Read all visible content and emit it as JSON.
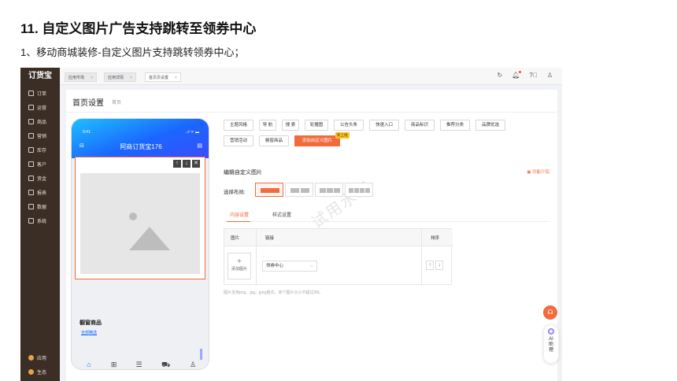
{
  "doc": {
    "title": "11. 自定义图片广告支持跳转至领券中心",
    "subtitle": "1、移动商城装修-自定义图片支持跳转领券中心；"
  },
  "sidebar": {
    "logo": "订货宝",
    "items": [
      {
        "label": "订单",
        "icon": "order-icon"
      },
      {
        "label": "运营",
        "icon": "operation-icon"
      },
      {
        "label": "商品",
        "icon": "goods-icon"
      },
      {
        "label": "营销",
        "icon": "marketing-icon"
      },
      {
        "label": "库存",
        "icon": "warehouse-icon"
      },
      {
        "label": "客户",
        "icon": "customer-icon"
      },
      {
        "label": "资金",
        "icon": "fund-icon"
      },
      {
        "label": "报表",
        "icon": "report-icon"
      },
      {
        "label": "数据",
        "icon": "data-icon"
      },
      {
        "label": "系统",
        "icon": "system-icon"
      }
    ],
    "bottom_items": [
      {
        "label": "应用",
        "icon": "apps-icon"
      },
      {
        "label": "生态",
        "icon": "ecosystem-icon"
      }
    ]
  },
  "tabs": [
    {
      "label": "应用市场",
      "close": "×"
    },
    {
      "label": "应用详情",
      "close": "×"
    },
    {
      "label": "首页页设置",
      "close": "×"
    }
  ],
  "top_icons": [
    "refresh-icon",
    "bell-icon",
    "help-icon",
    "user-icon"
  ],
  "page": {
    "title": "首页设置",
    "crumb": "首页"
  },
  "phone": {
    "time": "9:41",
    "signal": "..ıl ᯤ ▬",
    "app_title": "阿商订货宝176",
    "controls": [
      "↑",
      "↓",
      "✕"
    ],
    "window_title": "橱窗商品",
    "window_link": "全部精选",
    "nav": [
      {
        "label": "首页",
        "glyph": "⌂"
      },
      {
        "label": "分类",
        "glyph": "⊞"
      },
      {
        "label": "订单",
        "glyph": "☰"
      },
      {
        "label": "购物车",
        "glyph": "⛟"
      },
      {
        "label": "我的",
        "glyph": "♙"
      }
    ]
  },
  "components": {
    "row1": [
      "主题风格",
      "导 航",
      "搜 索",
      "轮播图",
      "公告头条",
      "快速入口",
      "商品标识",
      "推荐分类",
      "品牌优选"
    ],
    "row2": [
      "营销活动",
      "橱窗商品",
      "添加自定义图片"
    ],
    "new_badge": "新上线"
  },
  "editor": {
    "title": "编辑自定义图片",
    "help": "功能介绍",
    "layout_label": "选择布局:",
    "sub_tabs": [
      "内容设置",
      "样式设置"
    ],
    "table_headers": [
      "图片",
      "链接",
      "排序"
    ],
    "add_image": "添加图片",
    "link_value": "领券中心",
    "sort_up": "↑",
    "sort_down": "↓",
    "hint": "图片支持png、jpg、jpeg格式，单个图片大小不超过2M。"
  },
  "watermark": "试用水印",
  "fab": {
    "service_icon": "headset-icon",
    "ai_lines": [
      "AI",
      "助",
      "理"
    ]
  },
  "colors": {
    "accent": "#f16b3d",
    "sidebar_bg": "#3a2e25",
    "phone_header": "#1a66ff"
  }
}
